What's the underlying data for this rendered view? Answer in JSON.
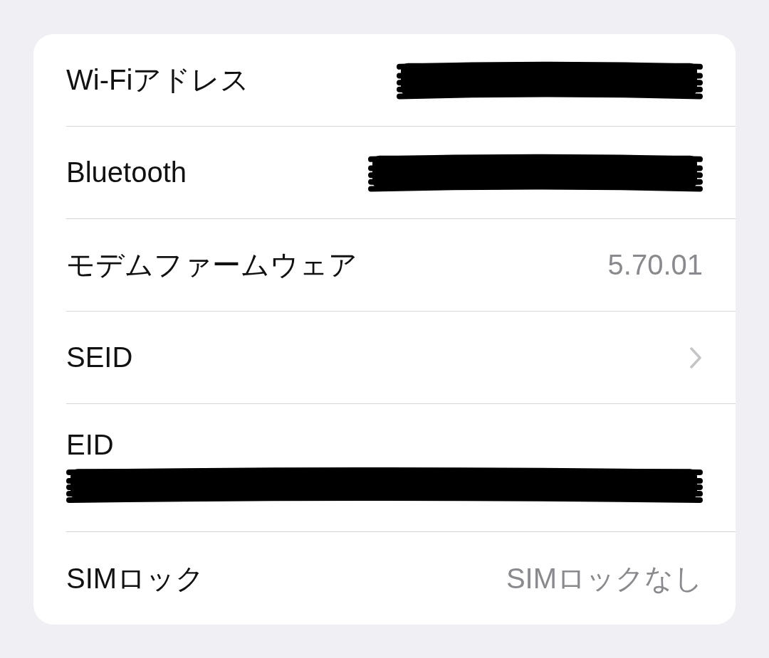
{
  "rows": [
    {
      "kind": "value",
      "label": "Wi-Fiアドレス",
      "redacted": true
    },
    {
      "kind": "value",
      "label": "Bluetooth",
      "redacted": true
    },
    {
      "kind": "value",
      "label": "モデムファームウェア",
      "value": "5.70.01"
    },
    {
      "kind": "link",
      "label": "SEID"
    },
    {
      "kind": "stacked",
      "label": "EID",
      "redacted": true
    },
    {
      "kind": "value",
      "label": "SIMロック",
      "value": "SIMロックなし"
    }
  ]
}
